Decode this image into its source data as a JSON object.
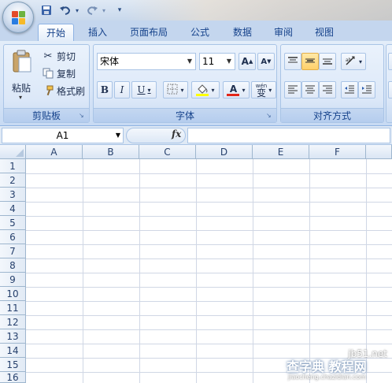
{
  "quick_access": {
    "save_icon": "save-icon",
    "undo_icon": "undo-icon",
    "redo_icon": "redo-icon",
    "customize_icon": "customize-qat-icon"
  },
  "tabs": [
    "开始",
    "插入",
    "页面布局",
    "公式",
    "数据",
    "审阅",
    "视图"
  ],
  "active_tab": "开始",
  "clipboard": {
    "paste_label": "粘贴",
    "cut_label": "剪切",
    "copy_label": "复制",
    "format_painter_label": "格式刷",
    "group_label": "剪贴板"
  },
  "font": {
    "font_name": "宋体",
    "font_size": "11",
    "grow_label": "A",
    "shrink_label": "A",
    "bold_label": "B",
    "italic_label": "I",
    "underline_label": "U",
    "font_color_label": "A",
    "wen_label": "wén",
    "wen_char": "变",
    "group_label": "字体"
  },
  "alignment": {
    "group_label": "对齐方式"
  },
  "formula_bar": {
    "name_box": "A1",
    "fx_label": "fx",
    "formula": ""
  },
  "grid": {
    "columns": [
      "A",
      "B",
      "C",
      "D",
      "E",
      "F"
    ],
    "rows": [
      "1",
      "2",
      "3",
      "4",
      "5",
      "6",
      "7",
      "8",
      "9",
      "10",
      "11",
      "12",
      "13",
      "14",
      "15",
      "16"
    ]
  },
  "watermark": {
    "site": "jb51.net",
    "title": "查字典 教程网",
    "sub": "jiaocheng.chazidian.com"
  },
  "colors": {
    "ribbon_bg": "#dbe7f7",
    "accent": "#15428b",
    "highlight": "#ffd97a",
    "font_color_red": "#e2271a",
    "fill_yellow": "#ffff00"
  }
}
